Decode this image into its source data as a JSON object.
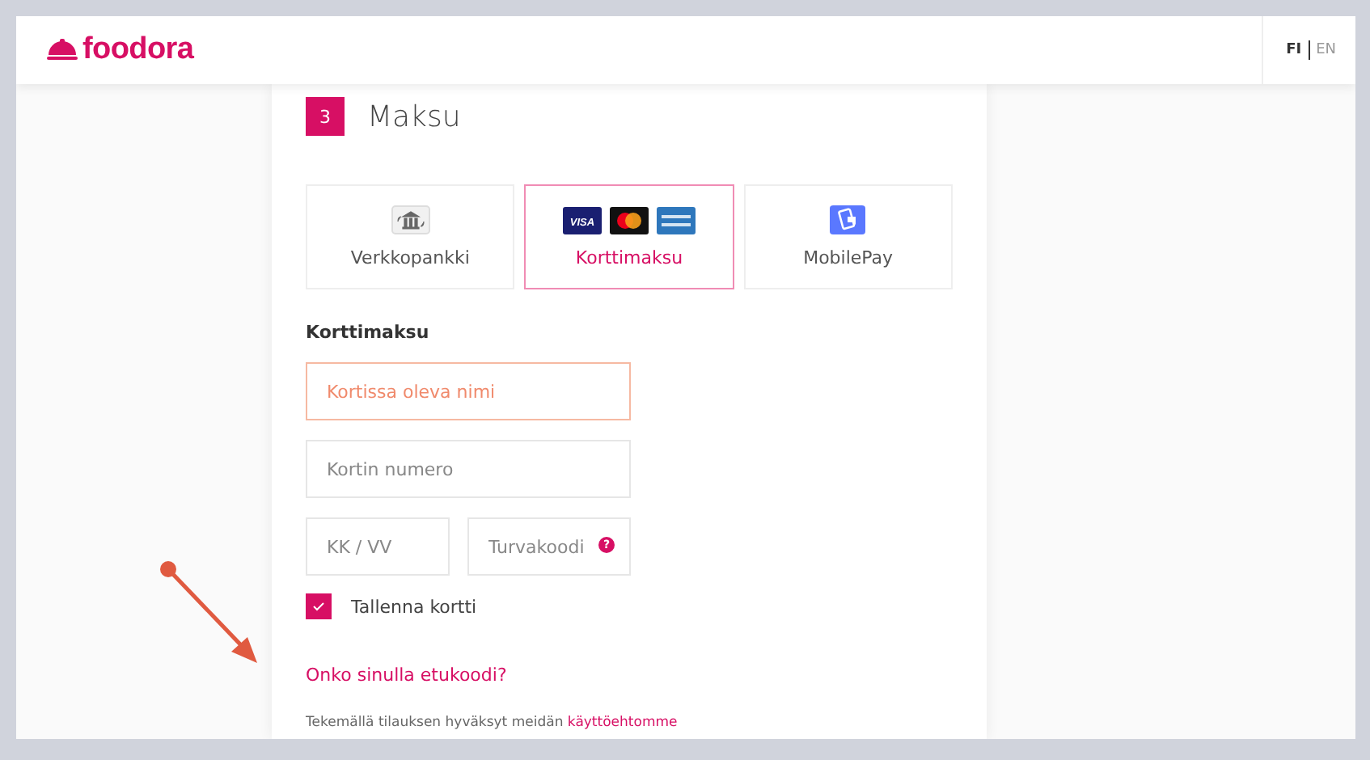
{
  "header": {
    "logo": "foodora",
    "languages": [
      {
        "label": "FI",
        "selected": true
      },
      {
        "label": "EN",
        "selected": false
      }
    ]
  },
  "step": {
    "number": "3",
    "title": "Maksu"
  },
  "payment_methods": [
    {
      "label": "Verkkopankki",
      "kind": "bank",
      "selected": false
    },
    {
      "label": "Korttimaksu",
      "kind": "cards",
      "selected": true,
      "card_text": "VISA"
    },
    {
      "label": "MobilePay",
      "kind": "mobile",
      "selected": false
    }
  ],
  "card_form": {
    "title": "Korttimaksu",
    "fields": [
      {
        "placeholder": "Kortissa oleva nimi",
        "error": true
      },
      {
        "placeholder": "Kortin numero",
        "error": false
      },
      {
        "placeholder": "KK / VV",
        "error": false
      },
      {
        "placeholder": "Turvakoodi",
        "error": false,
        "help": "?"
      }
    ],
    "save_card": {
      "label": "Tallenna kortti",
      "checked": true
    }
  },
  "promo_link": "Onko sinulla etukoodi?",
  "terms": {
    "text": "Tekemällä tilauksen hyväksyt meidän",
    "link": "käyttöehtomme"
  }
}
